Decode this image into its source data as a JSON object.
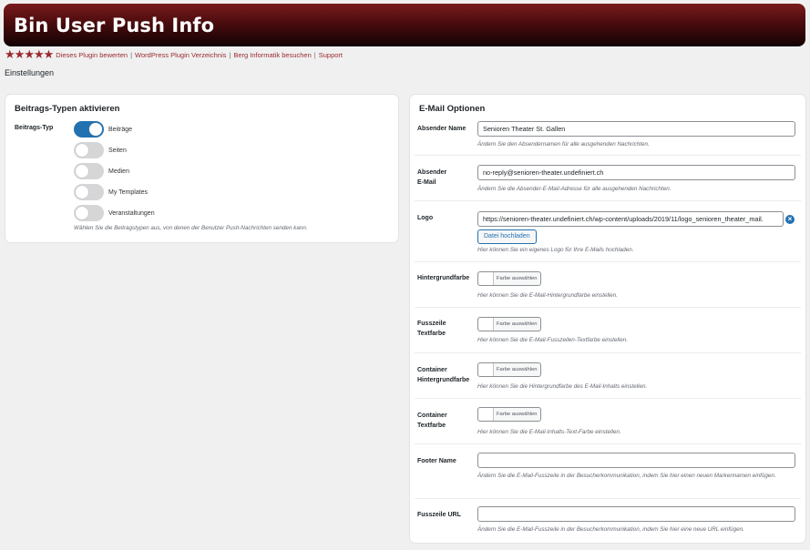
{
  "header": {
    "title": "Bin User Push Info"
  },
  "links": {
    "rating_stars": 5,
    "rate": "Dieses Plugin bewerten",
    "directory": "WordPress Plugin Verzeichnis",
    "visit": "Berg Informatik besuchen",
    "support": "Support",
    "separator": "|"
  },
  "page_subtitle": "Einstellungen",
  "post_types": {
    "title": "Beitrags-Typen aktivieren",
    "label": "Beitrags-Typ",
    "items": [
      {
        "label": "Beiträge",
        "enabled": true
      },
      {
        "label": "Seiten",
        "enabled": false
      },
      {
        "label": "Medien",
        "enabled": false
      },
      {
        "label": "My Templates",
        "enabled": false
      },
      {
        "label": "Veranstaltungen",
        "enabled": false
      }
    ],
    "help": "Wählen Sie die Beitragstypen aus, von denen der Benutzer Push-Nachrichten senden kann."
  },
  "email": {
    "title": "E-Mail Optionen",
    "sender_name": {
      "label": "Absender Name",
      "value": "Senioren Theater St. Gallen",
      "help": "Ändern Sie den Absendernamen für alle ausgehenden Nachrichten."
    },
    "sender_email": {
      "label_line1": "Absender",
      "label_line2": "E-Mail",
      "value": "no-reply@senioren-theater.undefiniert.ch",
      "help": "Ändern Sie die Absender-E-Mail-Adresse für alle ausgehenden Nachrichten."
    },
    "logo": {
      "label": "Logo",
      "value": "https://senioren-theater.undefiniert.ch/wp-content/uploads/2019/11/logo_senioren_theater_mail.",
      "button": "Datei hochladen",
      "clear_icon": "×",
      "help": "Hier können Sie ein eigenes Logo für Ihre E-Mails hochladen."
    },
    "color_button": "Farbe auswählen",
    "bg_color": {
      "label": "Hintergrundfarbe",
      "help": "Hier können Sie die E-Mail-Hintergrundfarbe einstellen."
    },
    "footer_text_color": {
      "label_line1": "Fusszeile",
      "label_line2": "Textfarbe",
      "help": "Hier können Sie die E-Mail-Fusszeilen-Textfarbe einstellen."
    },
    "container_bg": {
      "label_line1": "Container",
      "label_line2": "Hintergrundfarbe",
      "help": "Hier können Sie die Hintergrundfarbe des E-Mail-Inhalts einstellen."
    },
    "container_text": {
      "label_line1": "Container",
      "label_line2": "Textfarbe",
      "help": "Hier können Sie die E-Mail-Inhalts-Text-Farbe einstellen."
    },
    "footer_name": {
      "label": "Footer Name",
      "value": "",
      "help": "Ändern Sie die E-Mail-Fusszeile in der Besucherkommunikation, indem Sie hier einen neuen Markennamen einfügen."
    },
    "footer_url": {
      "label": "Fusszeile URL",
      "value": "",
      "help": "Ändern Sie die E-Mail-Fusszeile in der Besucherkommunikation, indem Sie hier eine neue URL einfügen."
    }
  },
  "colors": {
    "accent": "#2271b1",
    "brand": "#9b2a2d",
    "header_dark": "#120203"
  }
}
